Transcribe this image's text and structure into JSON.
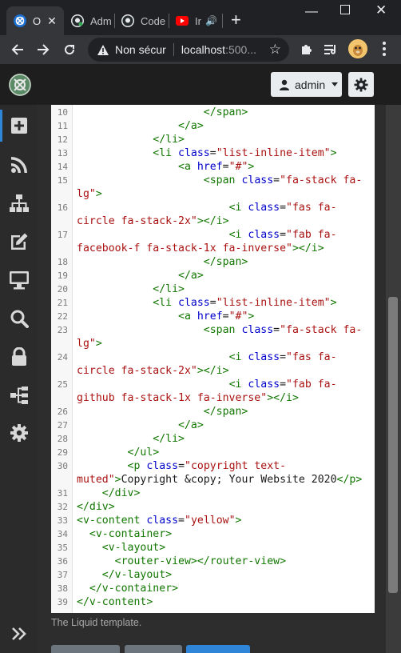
{
  "browser": {
    "tabs": [
      {
        "label": "O",
        "favicon": "app-favicon",
        "active": true
      },
      {
        "label": "Adm",
        "favicon": "github-favicon-green"
      },
      {
        "label": "Code",
        "favicon": "github-favicon"
      },
      {
        "label": "Ir",
        "favicon": "youtube-favicon",
        "audio": true
      }
    ],
    "security_label": "Non sécur",
    "url_host": "localhost",
    "url_rest": ":500..."
  },
  "navbar": {
    "user_label": "admin"
  },
  "sidebar": {
    "items": [
      "add-square-icon",
      "rss-icon",
      "sitemap-icon",
      "edit-icon",
      "desktop-icon",
      "search-icon",
      "lock-icon",
      "tree-icon",
      "settings-icon"
    ]
  },
  "editor": {
    "lines": [
      {
        "n": "10",
        "indent": 20,
        "segs": [
          [
            "tag",
            "</span>"
          ]
        ]
      },
      {
        "n": "11",
        "indent": 16,
        "segs": [
          [
            "tag",
            "</a>"
          ]
        ]
      },
      {
        "n": "12",
        "indent": 12,
        "segs": [
          [
            "tag",
            "</li>"
          ]
        ]
      },
      {
        "n": "13",
        "indent": 12,
        "segs": [
          [
            "tag",
            "<li "
          ],
          [
            "attr",
            "class"
          ],
          [
            "plain",
            "="
          ],
          [
            "str",
            "\"list-inline-item\""
          ],
          [
            "tag",
            ">"
          ]
        ]
      },
      {
        "n": "14",
        "indent": 16,
        "segs": [
          [
            "tag",
            "<a "
          ],
          [
            "attr",
            "href"
          ],
          [
            "plain",
            "="
          ],
          [
            "str",
            "\"#\""
          ],
          [
            "tag",
            ">"
          ]
        ]
      },
      {
        "n": "15",
        "indent": 20,
        "segs": [
          [
            "tag",
            "<span "
          ],
          [
            "attr",
            "class"
          ],
          [
            "plain",
            "="
          ],
          [
            "str",
            "\"fa-stack fa-lg\""
          ],
          [
            "tag",
            ">"
          ]
        ]
      },
      {
        "n": "16",
        "indent": 24,
        "segs": [
          [
            "tag",
            "<i "
          ],
          [
            "attr",
            "class"
          ],
          [
            "plain",
            "="
          ],
          [
            "str",
            "\"fas fa-circle fa-stack-2x\""
          ],
          [
            "tag",
            "></i>"
          ]
        ]
      },
      {
        "n": "17",
        "indent": 24,
        "segs": [
          [
            "tag",
            "<i "
          ],
          [
            "attr",
            "class"
          ],
          [
            "plain",
            "="
          ],
          [
            "str",
            "\"fab fa-facebook-f fa-stack-1x fa-inverse\""
          ],
          [
            "tag",
            "></i>"
          ]
        ]
      },
      {
        "n": "18",
        "indent": 20,
        "segs": [
          [
            "tag",
            "</span>"
          ]
        ]
      },
      {
        "n": "19",
        "indent": 16,
        "segs": [
          [
            "tag",
            "</a>"
          ]
        ]
      },
      {
        "n": "20",
        "indent": 12,
        "segs": [
          [
            "tag",
            "</li>"
          ]
        ]
      },
      {
        "n": "21",
        "indent": 12,
        "segs": [
          [
            "tag",
            "<li "
          ],
          [
            "attr",
            "class"
          ],
          [
            "plain",
            "="
          ],
          [
            "str",
            "\"list-inline-item\""
          ],
          [
            "tag",
            ">"
          ]
        ]
      },
      {
        "n": "22",
        "indent": 16,
        "segs": [
          [
            "tag",
            "<a "
          ],
          [
            "attr",
            "href"
          ],
          [
            "plain",
            "="
          ],
          [
            "str",
            "\"#\""
          ],
          [
            "tag",
            ">"
          ]
        ]
      },
      {
        "n": "23",
        "indent": 20,
        "segs": [
          [
            "tag",
            "<span "
          ],
          [
            "attr",
            "class"
          ],
          [
            "plain",
            "="
          ],
          [
            "str",
            "\"fa-stack fa-lg\""
          ],
          [
            "tag",
            ">"
          ]
        ]
      },
      {
        "n": "24",
        "indent": 24,
        "segs": [
          [
            "tag",
            "<i "
          ],
          [
            "attr",
            "class"
          ],
          [
            "plain",
            "="
          ],
          [
            "str",
            "\"fas fa-circle fa-stack-2x\""
          ],
          [
            "tag",
            "></i>"
          ]
        ]
      },
      {
        "n": "25",
        "indent": 24,
        "segs": [
          [
            "tag",
            "<i "
          ],
          [
            "attr",
            "class"
          ],
          [
            "plain",
            "="
          ],
          [
            "str",
            "\"fab fa-github fa-stack-1x fa-inverse\""
          ],
          [
            "tag",
            "></i>"
          ]
        ]
      },
      {
        "n": "26",
        "indent": 20,
        "segs": [
          [
            "tag",
            "</span>"
          ]
        ]
      },
      {
        "n": "27",
        "indent": 16,
        "segs": [
          [
            "tag",
            "</a>"
          ]
        ]
      },
      {
        "n": "28",
        "indent": 12,
        "segs": [
          [
            "tag",
            "</li>"
          ]
        ]
      },
      {
        "n": "29",
        "indent": 8,
        "segs": [
          [
            "tag",
            "</ul>"
          ]
        ]
      },
      {
        "n": "30",
        "indent": 8,
        "segs": [
          [
            "tag",
            "<p "
          ],
          [
            "attr",
            "class"
          ],
          [
            "plain",
            "="
          ],
          [
            "str",
            "\"copyright text-muted\""
          ],
          [
            "tag",
            ">"
          ],
          [
            "plain",
            "Copyright &copy; Your Website 2020"
          ],
          [
            "tag",
            "</p>"
          ]
        ]
      },
      {
        "n": "31",
        "indent": 4,
        "segs": [
          [
            "tag",
            "</div>"
          ]
        ]
      },
      {
        "n": "32",
        "indent": 0,
        "segs": [
          [
            "tag",
            "</div>"
          ]
        ]
      },
      {
        "n": "33",
        "indent": 0,
        "segs": [
          [
            "tag",
            "<v-content "
          ],
          [
            "attr",
            "class"
          ],
          [
            "plain",
            "="
          ],
          [
            "str",
            "\"yellow\""
          ],
          [
            "tag",
            ">"
          ]
        ]
      },
      {
        "n": "34",
        "indent": 2,
        "segs": [
          [
            "tag",
            "<v-container>"
          ]
        ]
      },
      {
        "n": "35",
        "indent": 4,
        "segs": [
          [
            "tag",
            "<v-layout>"
          ]
        ]
      },
      {
        "n": "36",
        "indent": 6,
        "segs": [
          [
            "tag",
            "<router-view></router-view>"
          ]
        ]
      },
      {
        "n": "37",
        "indent": 4,
        "segs": [
          [
            "tag",
            "</v-layout>"
          ]
        ]
      },
      {
        "n": "38",
        "indent": 2,
        "segs": [
          [
            "tag",
            "</v-container>"
          ]
        ]
      },
      {
        "n": "39",
        "indent": 0,
        "segs": [
          [
            "tag",
            "</v-content>"
          ]
        ]
      }
    ]
  },
  "caption": "The Liquid template.",
  "colors": {
    "chrome_bg": "#202124",
    "toolbar_bg": "#35363a",
    "app_navbar": "#1e1e1e",
    "sidebar_bg": "#2b2b2b",
    "accent": "#2f86d9",
    "code_tag": "#117700",
    "code_attr": "#0000cc",
    "code_string": "#aa1111"
  }
}
